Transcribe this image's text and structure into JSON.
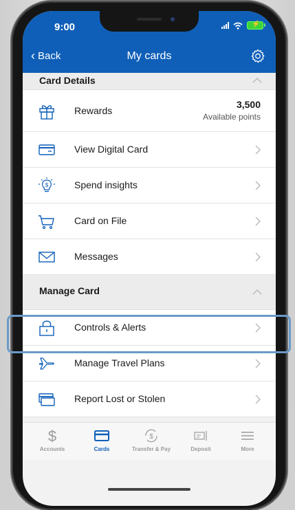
{
  "status": {
    "time": "9:00"
  },
  "nav": {
    "back_label": "Back",
    "title": "My cards"
  },
  "sections": {
    "card_details": "Card Details",
    "manage_card": "Manage Card"
  },
  "rows": {
    "rewards": {
      "label": "Rewards",
      "points": "3,500",
      "points_caption": "Available points"
    },
    "view_digital_card": "View Digital Card",
    "spend_insights": "Spend insights",
    "card_on_file": "Card on File",
    "messages": "Messages",
    "controls_alerts": "Controls & Alerts",
    "manage_travel_plans": "Manage Travel Plans",
    "report_lost_stolen": "Report Lost or Stolen"
  },
  "tabs": {
    "accounts": "Accounts",
    "cards": "Cards",
    "transfer_pay": "Transfer & Pay",
    "deposit": "Deposit",
    "more": "More"
  },
  "colors": {
    "brand": "#0f5fb8",
    "highlight": "#6b9ac9",
    "battery": "#3cd43a"
  }
}
